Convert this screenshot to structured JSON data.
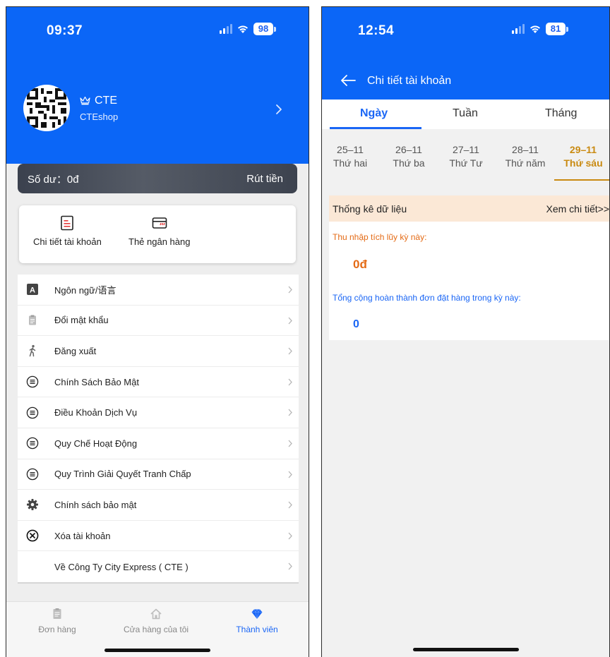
{
  "left_screen": {
    "status": {
      "time": "09:37",
      "battery": "98"
    },
    "profile": {
      "name": "CTE",
      "subtitle": "CTEshop"
    },
    "balance": {
      "label": "Số dư：0đ",
      "withdraw": "Rút tiền"
    },
    "quick_actions": [
      {
        "label": "Chi tiết tài khoản",
        "icon": "account-detail-icon"
      },
      {
        "label": "Thẻ ngân hàng",
        "icon": "bank-card-icon"
      }
    ],
    "menu": [
      {
        "label": "Ngôn ngữ/语言",
        "icon": "language-icon"
      },
      {
        "label": "Đổi mật khẩu",
        "icon": "clipboard-icon"
      },
      {
        "label": "Đăng xuất",
        "icon": "walking-person-icon"
      },
      {
        "label": "Chính Sách Bảo Mật",
        "icon": "list-icon"
      },
      {
        "label": "Điều Khoản Dịch Vụ",
        "icon": "list-icon"
      },
      {
        "label": "Quy Chế Hoạt Động",
        "icon": "list-icon"
      },
      {
        "label": "Quy Trình Giải Quyết Tranh Chấp",
        "icon": "list-icon"
      },
      {
        "label": "Chính sách bảo mật",
        "icon": "gear-icon"
      },
      {
        "label": "Xóa tài khoản",
        "icon": "close-circle-icon"
      },
      {
        "label": "Về Công Ty City Express ( CTE )",
        "icon": ""
      }
    ],
    "tabs": [
      {
        "label": "Đơn hàng",
        "icon": "orders-icon"
      },
      {
        "label": "Cửa hàng của tôi",
        "icon": "home-icon"
      },
      {
        "label": "Thành viên",
        "icon": "diamond-icon",
        "active": true
      }
    ]
  },
  "right_screen": {
    "status": {
      "time": "12:54",
      "battery": "81"
    },
    "title": "Chi tiết tài khoản",
    "period_tabs": [
      "Ngày",
      "Tuần",
      "Tháng"
    ],
    "days": [
      {
        "date": "25–11",
        "weekday": "Thứ hai"
      },
      {
        "date": "26–11",
        "weekday": "Thứ ba"
      },
      {
        "date": "27–11",
        "weekday": "Thứ Tư"
      },
      {
        "date": "28–11",
        "weekday": "Thứ năm"
      },
      {
        "date": "29–11",
        "weekday": "Thứ sáu",
        "active": true
      }
    ],
    "stats": {
      "title": "Thống kê dữ liệu",
      "details_link": "Xem chi tiết>>",
      "income_label": "Thu nhập tích lũy kỳ này:",
      "income_value": "0đ",
      "orders_label": "Tổng cộng hoàn thành đơn đặt hàng trong kỳ này:",
      "orders_value": "0"
    }
  },
  "colors": {
    "primary_blue": "#0b66f7",
    "accent_orange": "#e46b16",
    "accent_gold": "#c98a11"
  }
}
